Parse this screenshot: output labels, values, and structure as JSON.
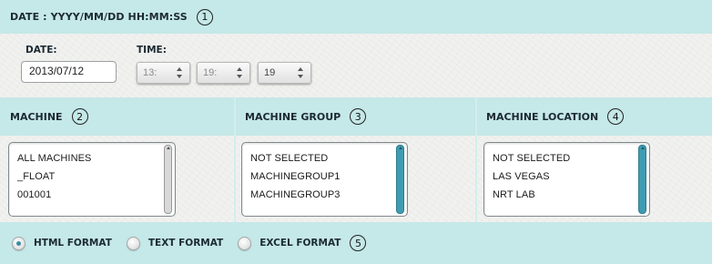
{
  "header": {
    "title": "DATE : YYYY/MM/DD HH:MM:SS",
    "number": "1"
  },
  "datetime": {
    "date_label": "DATE:",
    "date_value": "2013/07/12",
    "time_label": "TIME:",
    "hour": "13:",
    "minute": "19:",
    "second": "19"
  },
  "machine": {
    "label": "MACHINE",
    "number": "2",
    "items": [
      "ALL MACHINES",
      "_FLOAT",
      "001001"
    ]
  },
  "machine_group": {
    "label": "MACHINE GROUP",
    "number": "3",
    "items": [
      "NOT SELECTED",
      "MACHINEGROUP1",
      "MACHINEGROUP3"
    ]
  },
  "machine_location": {
    "label": "MACHINE LOCATION",
    "number": "4",
    "items": [
      "NOT SELECTED",
      "LAS VEGAS",
      "NRT LAB"
    ]
  },
  "formats": {
    "number": "5",
    "selected": "HTML FORMAT",
    "options": [
      "HTML FORMAT",
      "TEXT FORMAT",
      "EXCEL FORMAT"
    ]
  },
  "colors": {
    "background": "#c5e8e8",
    "panel": "#f1f1ef",
    "scrollbar_active": "#3f9cb2"
  }
}
